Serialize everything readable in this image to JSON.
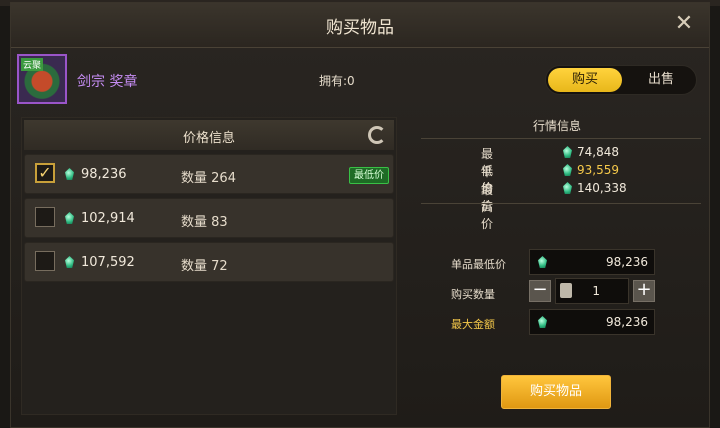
{
  "dialog": {
    "title": "购买物品"
  },
  "item": {
    "name": "剑宗 奖章",
    "owned": "拥有:0",
    "icon_tag": "云聚"
  },
  "tabs": {
    "buy": "购买",
    "sell": "出售"
  },
  "price_panel": {
    "title": "价格信息",
    "rows": [
      {
        "price": "98,236",
        "qty_label": "数量",
        "qty": "264",
        "checked": true,
        "tag": "最低价"
      },
      {
        "price": "102,914",
        "qty_label": "数量",
        "qty": "83",
        "checked": false
      },
      {
        "price": "107,592",
        "qty_label": "数量",
        "qty": "72",
        "checked": false
      }
    ]
  },
  "market": {
    "title": "行情信息",
    "lowest_label": "最低价",
    "lowest": "74,848",
    "avg_label": "平均价",
    "avg": "93,559",
    "highest_label": "最高价",
    "highest": "140,338"
  },
  "form": {
    "unit_label": "单品最低价",
    "unit_value": "98,236",
    "qty_label": "购买数量",
    "qty_value": "1",
    "total_label": "最大金额",
    "total_value": "98,236",
    "buy_button": "购买物品"
  },
  "colors": {
    "accent": "#f6c94a",
    "item_name": "#c58cf2",
    "low_tag": "#1e6b25"
  }
}
